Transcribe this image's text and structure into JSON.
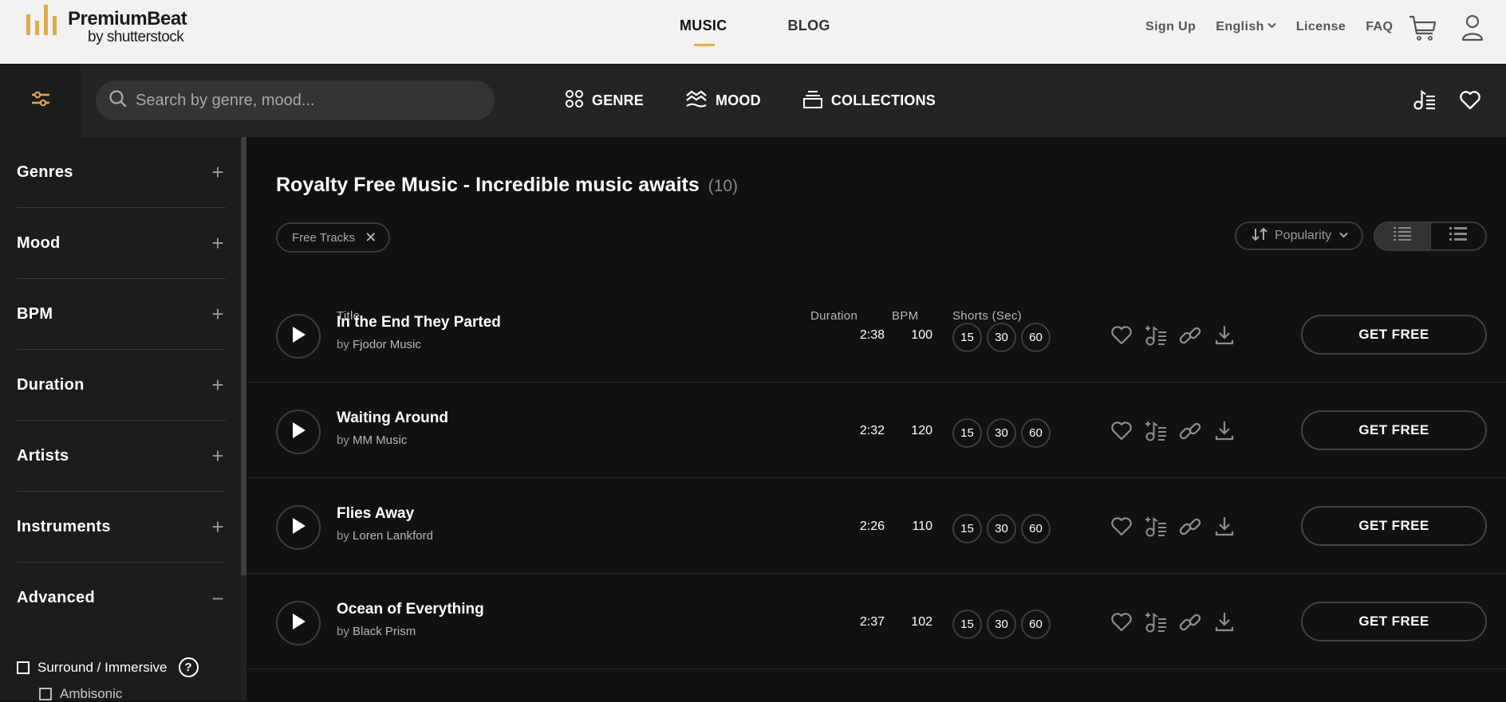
{
  "header": {
    "logo_title": "PremiumBeat",
    "logo_subtitle": "by shutterstock",
    "main_nav": [
      {
        "label": "MUSIC",
        "active": true
      },
      {
        "label": "BLOG",
        "active": false
      }
    ],
    "right_nav": {
      "sign_up": "Sign Up",
      "language": "English",
      "license": "License",
      "faq": "FAQ"
    },
    "icons": {
      "cart": "cart-icon",
      "account": "user-icon"
    }
  },
  "search_bar": {
    "filter_icon": "sliders-icon",
    "placeholder": "Search by genre, mood...",
    "value": "",
    "categories": [
      {
        "label": "GENRE",
        "icon": "grid-circles-icon"
      },
      {
        "label": "MOOD",
        "icon": "waves-icon"
      },
      {
        "label": "COLLECTIONS",
        "icon": "stack-icon"
      }
    ],
    "right_icons": [
      "playlist-icon",
      "heart-icon"
    ]
  },
  "sidebar": {
    "facets": [
      {
        "label": "Genres",
        "toggle": "+"
      },
      {
        "label": "Mood",
        "toggle": "+"
      },
      {
        "label": "BPM",
        "toggle": "+"
      },
      {
        "label": "Duration",
        "toggle": "+"
      },
      {
        "label": "Artists",
        "toggle": "+"
      },
      {
        "label": "Instruments",
        "toggle": "+"
      },
      {
        "label": "Advanced",
        "toggle": "−"
      }
    ],
    "advanced_options": [
      {
        "label": "Surround / Immersive",
        "checked": false,
        "help": "?"
      },
      {
        "label": "Ambisonic",
        "checked": false
      }
    ]
  },
  "main": {
    "title": "Royalty Free Music - Incredible music awaits",
    "count": "(10)",
    "active_filters": [
      {
        "label": "Free Tracks",
        "remove": "✕"
      }
    ],
    "sort": {
      "label": "Popularity"
    },
    "view_modes": [
      "list-detailed",
      "list-compact"
    ],
    "columns": {
      "title": "Title",
      "duration": "Duration",
      "bpm": "BPM",
      "shorts": "Shorts (Sec)"
    },
    "tracks": [
      {
        "title": "In the End They Parted",
        "by": "by",
        "artist": "Fjodor Music",
        "duration": "2:38",
        "bpm": "100",
        "shorts": [
          "15",
          "30",
          "60"
        ],
        "cta": "GET FREE"
      },
      {
        "title": "Waiting Around",
        "by": "by",
        "artist": "MM Music",
        "duration": "2:32",
        "bpm": "120",
        "shorts": [
          "15",
          "30",
          "60"
        ],
        "cta": "GET FREE"
      },
      {
        "title": "Flies Away",
        "by": "by",
        "artist": "Loren Lankford",
        "duration": "2:26",
        "bpm": "110",
        "shorts": [
          "15",
          "30",
          "60"
        ],
        "cta": "GET FREE"
      },
      {
        "title": "Ocean of Everything",
        "by": "by",
        "artist": "Black Prism",
        "duration": "2:37",
        "bpm": "102",
        "shorts": [
          "15",
          "30",
          "60"
        ],
        "cta": "GET FREE"
      }
    ]
  },
  "colors": {
    "accent": "#e0aa48",
    "header_bg": "#f2f2f2",
    "toolbar_bg": "#242424",
    "sidebar_bg": "#1c1c1c",
    "content_bg": "#111111"
  }
}
